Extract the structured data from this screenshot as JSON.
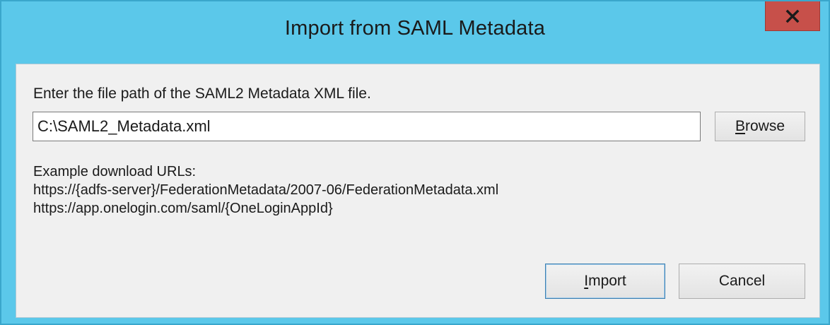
{
  "window": {
    "title": "Import from SAML Metadata",
    "close_label": "x"
  },
  "form": {
    "prompt": "Enter the file path of the SAML2 Metadata XML file.",
    "file_path_value": "C:\\SAML2_Metadata.xml",
    "browse_access_key": "B",
    "browse_rest": "rowse"
  },
  "examples": {
    "heading": "Example download URLs:",
    "urls": [
      "https://{adfs-server}/FederationMetadata/2007-06/FederationMetadata.xml",
      "https://app.onelogin.com/saml/{OneLoginAppId}"
    ]
  },
  "buttons": {
    "import_access_key": "I",
    "import_rest": "mport",
    "cancel_label": "Cancel"
  },
  "colors": {
    "titlebar": "#5bc8ea",
    "close_button": "#c7504a",
    "client_area": "#f0f0f0"
  },
  "icons": {
    "close": "close-x-icon"
  }
}
